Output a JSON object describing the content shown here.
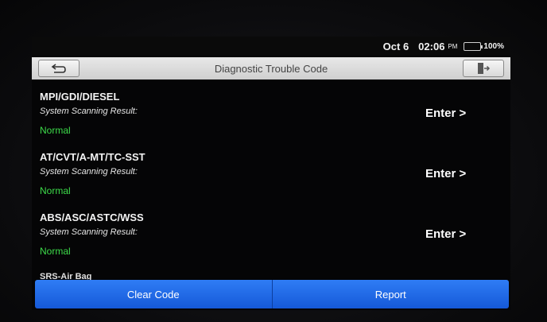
{
  "status_bar": {
    "date": "Oct 6",
    "time": "02:06",
    "ampm": "PM",
    "battery_level": 1.0,
    "battery_text": "100%",
    "battery_icon": "battery-icon",
    "battery_color": "#27c93f"
  },
  "header": {
    "title": "Diagnostic Trouble Code",
    "back_icon": "back-arrow-icon",
    "exit_icon": "exit-door-icon"
  },
  "systems": [
    {
      "name": "MPI/GDI/DIESEL",
      "label": "System Scanning Result:",
      "status": "Normal",
      "action": "Enter >"
    },
    {
      "name": "AT/CVT/A-MT/TC-SST",
      "label": "System Scanning Result:",
      "status": "Normal",
      "action": "Enter >"
    },
    {
      "name": "ABS/ASC/ASTC/WSS",
      "label": "System Scanning Result:",
      "status": "Normal",
      "action": "Enter >"
    }
  ],
  "partial_item": "SRS-Air Bag",
  "bottom_bar": {
    "clear_label": "Clear Code",
    "report_label": "Report",
    "button_color": "#1f6be6"
  },
  "colors": {
    "normal_status": "#3ddc4a",
    "background": "#050506"
  }
}
